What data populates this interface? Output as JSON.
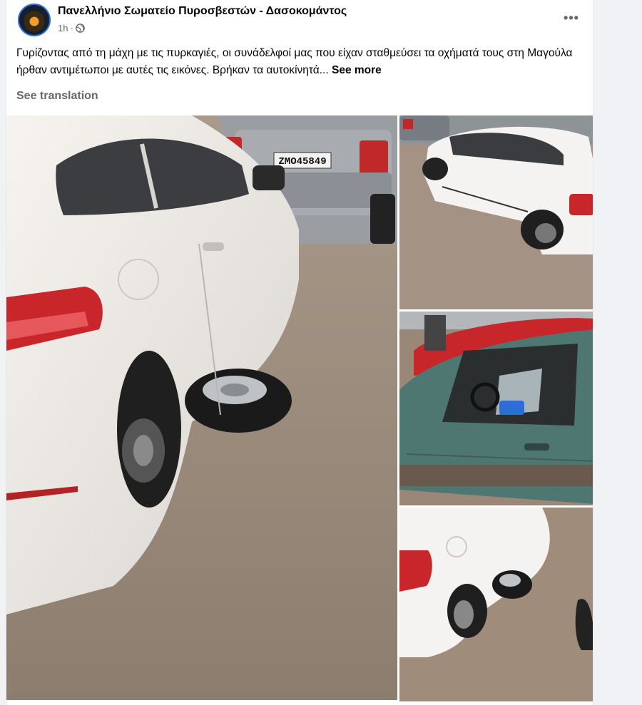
{
  "post": {
    "page_name": "Πανελλήνιο Σωματείο Πυροσβεστών - Δασοκομάντος",
    "time": "1h",
    "separator": "·",
    "audience_icon": "globe-icon",
    "more_icon": "more-options-icon",
    "more_label": "•••",
    "caption": "Γυρίζοντας από τη μάχη με τις πυρκαγιές, οι συνάδελφοί μας που είχαν σταθμεύσει τα οχήματά τους στη Μαγούλα ήρθαν αντιμέτωποι με αυτές τις εικόνες. Βρήκαν τα αυτοκίνητά...",
    "see_more": "See more",
    "see_translation": "See translation"
  },
  "photos": {
    "main_plate": "ZMO45849",
    "items": [
      "photo-1",
      "photo-2",
      "photo-3",
      "photo-4"
    ]
  },
  "colors": {
    "link_blue": "#2d6cdf",
    "text_primary": "#050505",
    "text_secondary": "#65676b",
    "background": "#f0f2f5"
  }
}
